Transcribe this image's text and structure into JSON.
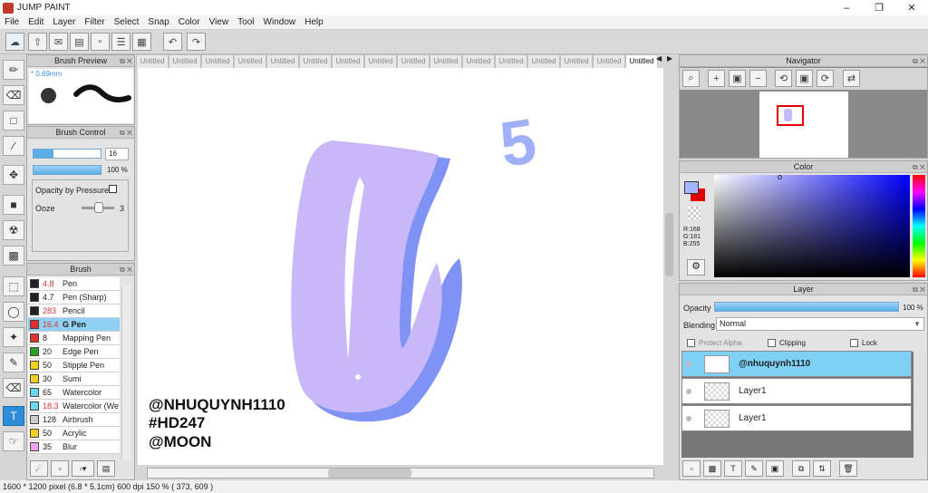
{
  "app": {
    "title": "JUMP PAINT"
  },
  "menu": [
    "File",
    "Edit",
    "Layer",
    "Filter",
    "Select",
    "Snap",
    "Color",
    "View",
    "Tool",
    "Window",
    "Help"
  ],
  "brush_preview": {
    "title": "Brush Preview",
    "size_label": "* 0.69mm"
  },
  "brush_control": {
    "title": "Brush Control",
    "size_value": "16",
    "opacity_value": "100 %",
    "opacity_pressure_label": "Opacity by Pressure",
    "ooze_label": "Ooze",
    "ooze_value": "3"
  },
  "brush_list": {
    "title": "Brush",
    "items": [
      {
        "size": "4.8",
        "name": "Pen",
        "color": "#222222",
        "size_color": "#d33"
      },
      {
        "size": "4.7",
        "name": "Pen (Sharp)",
        "color": "#222222",
        "size_color": "#222"
      },
      {
        "size": "283",
        "name": "Pencil",
        "color": "#222222",
        "size_color": "#d33"
      },
      {
        "size": "16.4",
        "name": "G Pen",
        "color": "#e03030",
        "size_color": "#d33",
        "selected": true
      },
      {
        "size": "8",
        "name": "Mapping Pen",
        "color": "#e03030",
        "size_color": "#222"
      },
      {
        "size": "20",
        "name": "Edge Pen",
        "color": "#2aa02a",
        "size_color": "#222"
      },
      {
        "size": "50",
        "name": "Stipple Pen",
        "color": "#f0d020",
        "size_color": "#222"
      },
      {
        "size": "30",
        "name": "Sumi",
        "color": "#f0d020",
        "size_color": "#222"
      },
      {
        "size": "65",
        "name": "Watercolor",
        "color": "#6ad6f0",
        "size_color": "#222"
      },
      {
        "size": "18.3",
        "name": "Watercolor (We",
        "color": "#6ad6f0",
        "size_color": "#d33"
      },
      {
        "size": "128",
        "name": "Airbrush",
        "color": "#cccccc",
        "size_color": "#222"
      },
      {
        "size": "50",
        "name": "Acrylic",
        "color": "#f0d020",
        "size_color": "#222"
      },
      {
        "size": "35",
        "name": "Blur",
        "color": "#f0a0f0",
        "size_color": "#222"
      }
    ]
  },
  "tabs": [
    "Untitled",
    "Untitled",
    "Untitled",
    "Untitled",
    "Untitled",
    "Untitled",
    "Untitled",
    "Untitled",
    "Untitled",
    "Untitled",
    "Untitled",
    "Untitled",
    "Untitled",
    "Untitled",
    "Untitled",
    "Untitled"
  ],
  "canvas": {
    "watermark_lines": [
      "@NHUQUYNH1110",
      "#HD247",
      "@MOON"
    ],
    "number": "5"
  },
  "navigator": {
    "title": "Navigator"
  },
  "color": {
    "title": "Color",
    "r": "R:168",
    "g": "G:181",
    "b": "B:255",
    "fg": "#a8b5ff",
    "bg": "#e00000"
  },
  "layer": {
    "title": "Layer",
    "opacity_label": "Opacity",
    "opacity_value": "100 %",
    "blending_label": "Blending",
    "blending_value": "Normal",
    "protect_alpha": "Protect Alpha",
    "clipping": "Clipping",
    "lock": "Lock",
    "layers": [
      "@nhuquynh1110",
      "Layer1",
      "Layer1"
    ]
  },
  "status": {
    "text": "1600 * 1200 pixel  (6.8 * 5.1cm)  600 dpi  150 %  ( 373, 609 )"
  }
}
